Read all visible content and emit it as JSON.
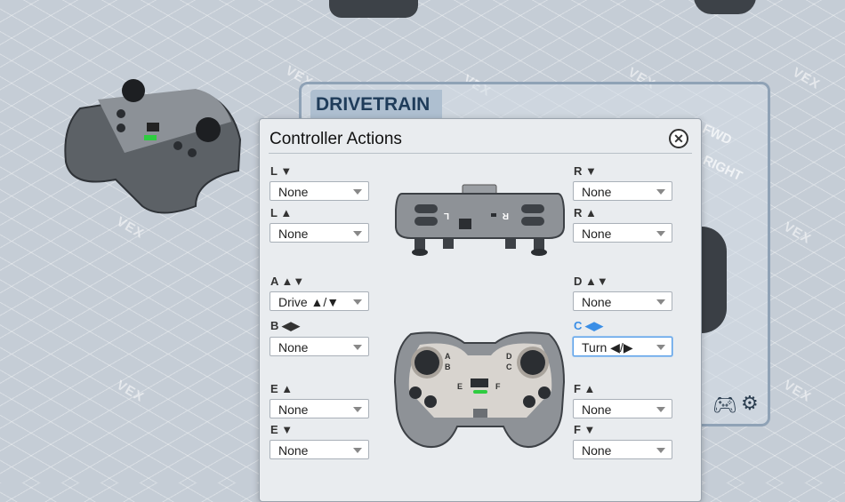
{
  "background": {
    "watermark": "VEX",
    "panel_title": "DRIVETRAIN",
    "panel_bg_labels": [
      "FWD",
      "RIGHT"
    ]
  },
  "dialog": {
    "title": "Controller Actions",
    "close_icon": "close-circle-icon"
  },
  "bindings": {
    "l_down": {
      "label": "L ▼",
      "value": "None"
    },
    "l_up": {
      "label": "L ▲",
      "value": "None"
    },
    "r_down": {
      "label": "R ▼",
      "value": "None"
    },
    "r_up": {
      "label": "R ▲",
      "value": "None"
    },
    "a": {
      "label": "A ▲▼",
      "value": "Drive ▲/▼"
    },
    "b": {
      "label": "B ◀▶",
      "value": "None"
    },
    "d": {
      "label": "D ▲▼",
      "value": "None"
    },
    "c": {
      "label": "C ◀▶",
      "value": "Turn ◀/▶"
    },
    "e_up": {
      "label": "E ▲",
      "value": "None"
    },
    "e_down": {
      "label": "E ▼",
      "value": "None"
    },
    "f_up": {
      "label": "F ▲",
      "value": "None"
    },
    "f_down": {
      "label": "F ▼",
      "value": "None"
    }
  },
  "controller_diagram": {
    "top_labels": [
      "L",
      "R"
    ],
    "front_labels": [
      "A",
      "B",
      "D",
      "C",
      "E",
      "F"
    ]
  },
  "colors": {
    "active": "#3a8ee6",
    "panel_title": "#1f3c5a"
  }
}
